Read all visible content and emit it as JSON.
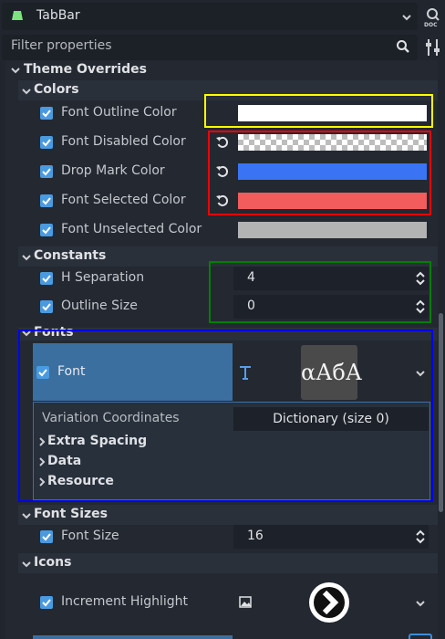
{
  "header": {
    "node_name": "TabBar",
    "filter_placeholder": "Filter properties",
    "doc_label": "DOC"
  },
  "colors_accent": {
    "checkbox": "#4a9ae0",
    "font_highlight": "#3b6fa0",
    "yellow_box": "#ffff00",
    "red_box": "#ff0000",
    "green_box": "#008000",
    "blue_box": "#0000ff"
  },
  "inspector": {
    "theme_overrides": "Theme Overrides",
    "colors_section": "Colors",
    "colors": [
      {
        "label": "Font Outline Color",
        "color": "#ffffff",
        "revert": false,
        "checked": true
      },
      {
        "label": "Font Disabled Color",
        "color": "checker",
        "revert": true,
        "checked": true
      },
      {
        "label": "Drop Mark Color",
        "color": "#3b73f5",
        "revert": true,
        "checked": true
      },
      {
        "label": "Font Selected Color",
        "color": "#f25c5c",
        "revert": true,
        "checked": true
      },
      {
        "label": "Font Unselected Color",
        "color": "#b3b3b3",
        "revert": false,
        "checked": true
      }
    ],
    "constants_section": "Constants",
    "constants": [
      {
        "label": "H Separation",
        "value": "4"
      },
      {
        "label": "Outline Size",
        "value": "0"
      }
    ],
    "fonts_section": "Fonts",
    "font": {
      "label": "Font",
      "preview_text": "αАбА",
      "variation_label": "Variation Coordinates",
      "variation_value": "Dictionary (size 0)",
      "subgroups": [
        "Extra Spacing",
        "Data",
        "Resource"
      ]
    },
    "font_sizes_section": "Font Sizes",
    "font_size": {
      "label": "Font Size",
      "value": "16"
    },
    "icons_section": "Icons",
    "icon": {
      "label": "Increment Highlight"
    }
  }
}
